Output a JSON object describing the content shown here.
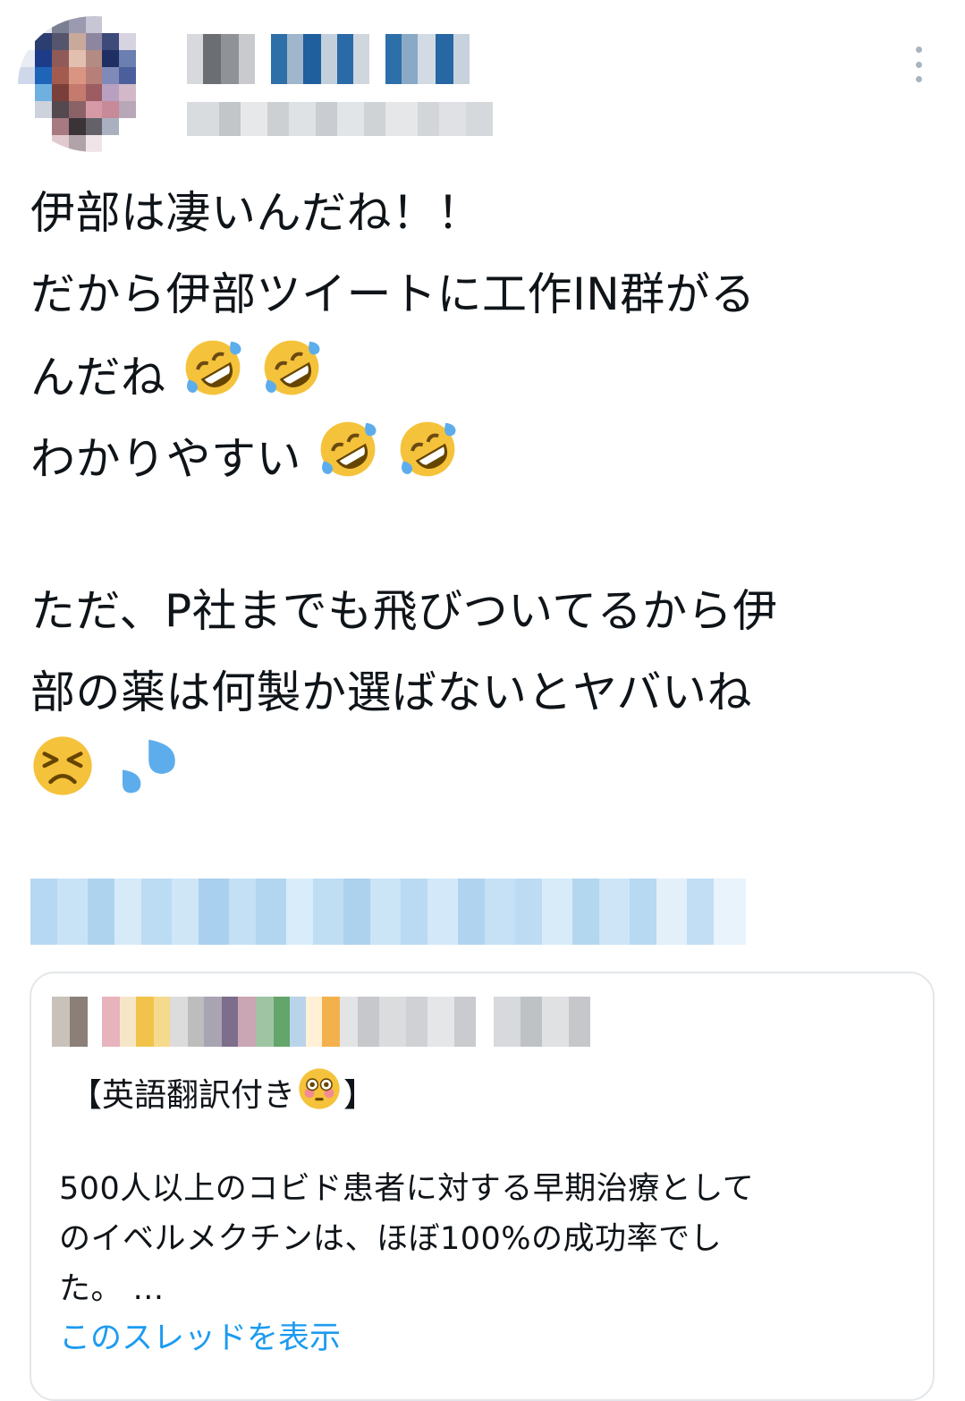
{
  "tweet": {
    "lines": [
      "伊部は凄いんだね！！",
      "だから伊部ツイートに工作IN群がる",
      "んだね",
      "わかりやすい",
      "ただ、P社までも飛びついてるから伊",
      "部の薬は何製か選ばないとヤバいね"
    ]
  },
  "quote": {
    "heading_open": "【英語翻訳付き",
    "heading_close": "】",
    "body_lines": [
      "500人以上のコビド患者に対する早期治療として",
      "のイベルメクチンは、ほぼ100%の成功率でし",
      "た。 ..."
    ],
    "show_thread": "このスレッドを表示"
  },
  "icons": {
    "more": "more-vertical-icon",
    "rofl": "rolling-on-floor-laughing-emoji",
    "persevere": "persevering-face-emoji",
    "sweat": "sweat-droplets-emoji",
    "flushed": "flushed-face-emoji"
  },
  "colors": {
    "link": "#1d9bf0",
    "text": "#0f1419",
    "border": "#e3e7ea"
  }
}
